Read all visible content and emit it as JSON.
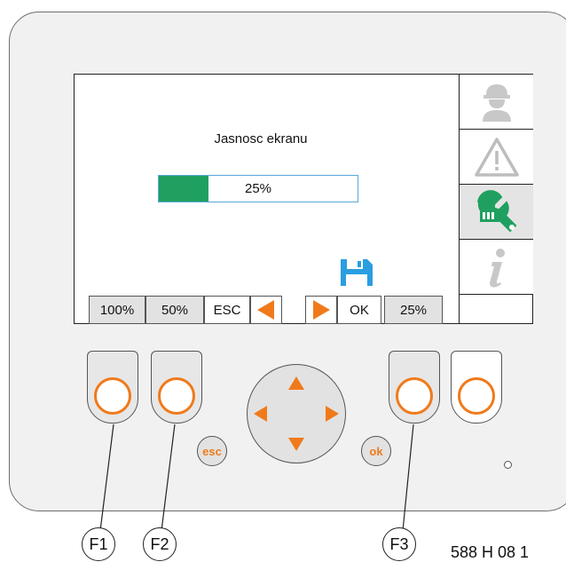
{
  "screen": {
    "title": "Jasnosc ekranu",
    "brightness": {
      "value_text": "25%",
      "fraction": 0.25
    }
  },
  "side_menu": [
    {
      "name": "operator",
      "icon": "operator-icon",
      "active": false
    },
    {
      "name": "warning",
      "icon": "warning-triangle-icon",
      "active": false
    },
    {
      "name": "service",
      "icon": "wrench-icon",
      "active": true
    },
    {
      "name": "info",
      "icon": "info-icon",
      "active": false
    }
  ],
  "function_bar": {
    "key1": "100%",
    "key2": "50%",
    "key3": "ESC",
    "key4_icon": "arrow-left-icon",
    "key5_icon": "arrow-right-icon",
    "key6": "OK",
    "key7": "25%",
    "save_icon": "save-icon"
  },
  "controls": {
    "esc_label": "esc",
    "ok_label": "ok"
  },
  "callouts": {
    "f1": "F1",
    "f2": "F2",
    "f3": "F3"
  },
  "figure_ref": "588 H 08 1",
  "colors": {
    "accent_orange": "#f07a1a",
    "fill_green": "#20a060",
    "save_blue": "#2a9ee0",
    "icon_grey": "#c8c8c8"
  }
}
